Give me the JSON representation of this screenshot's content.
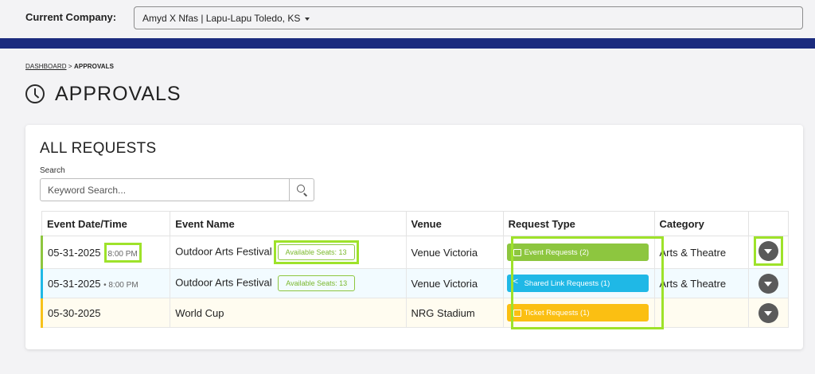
{
  "header": {
    "company_label": "Current Company:",
    "company_value": "Amyd X Nfas | Lapu-Lapu Toledo, KS"
  },
  "breadcrumb": {
    "dashboard": "DASHBOARD",
    "separator": ">",
    "current": "APPROVALS"
  },
  "page": {
    "title": "APPROVALS",
    "icon": "clock-icon"
  },
  "requests": {
    "title": "ALL REQUESTS",
    "search_label": "Search",
    "search_placeholder": "Keyword Search...",
    "columns": [
      "Event Date/Time",
      "Event Name",
      "Venue",
      "Request Type",
      "Category"
    ],
    "rows": [
      {
        "date": "05-31-2025",
        "time": "8:00 PM",
        "event": "Outdoor Arts Festival",
        "seats": "Available Seats: 13",
        "venue": "Venue Victoria",
        "request_type": "Event Requests (2)",
        "category": "Arts & Theatre",
        "accent": "#8dc63f"
      },
      {
        "date": "05-31-2025",
        "time": "• 8:00 PM",
        "event": "Outdoor Arts Festival",
        "seats": "Available Seats: 13",
        "venue": "Venue Victoria",
        "request_type": "Shared Link Requests (1)",
        "category": "Arts & Theatre",
        "accent": "#1fb8e6"
      },
      {
        "date": "05-30-2025",
        "time": "",
        "event": "World Cup",
        "seats": "",
        "venue": "NRG Stadium",
        "request_type": "Ticket Requests (1)",
        "category": "",
        "accent": "#f7c21b"
      }
    ]
  },
  "colors": {
    "nav_band": "#1b2b7e",
    "highlight": "#9ee22a",
    "event_green": "#8dc63f",
    "shared_blue": "#1fb8e6",
    "ticket_yellow": "#fbbf12"
  }
}
